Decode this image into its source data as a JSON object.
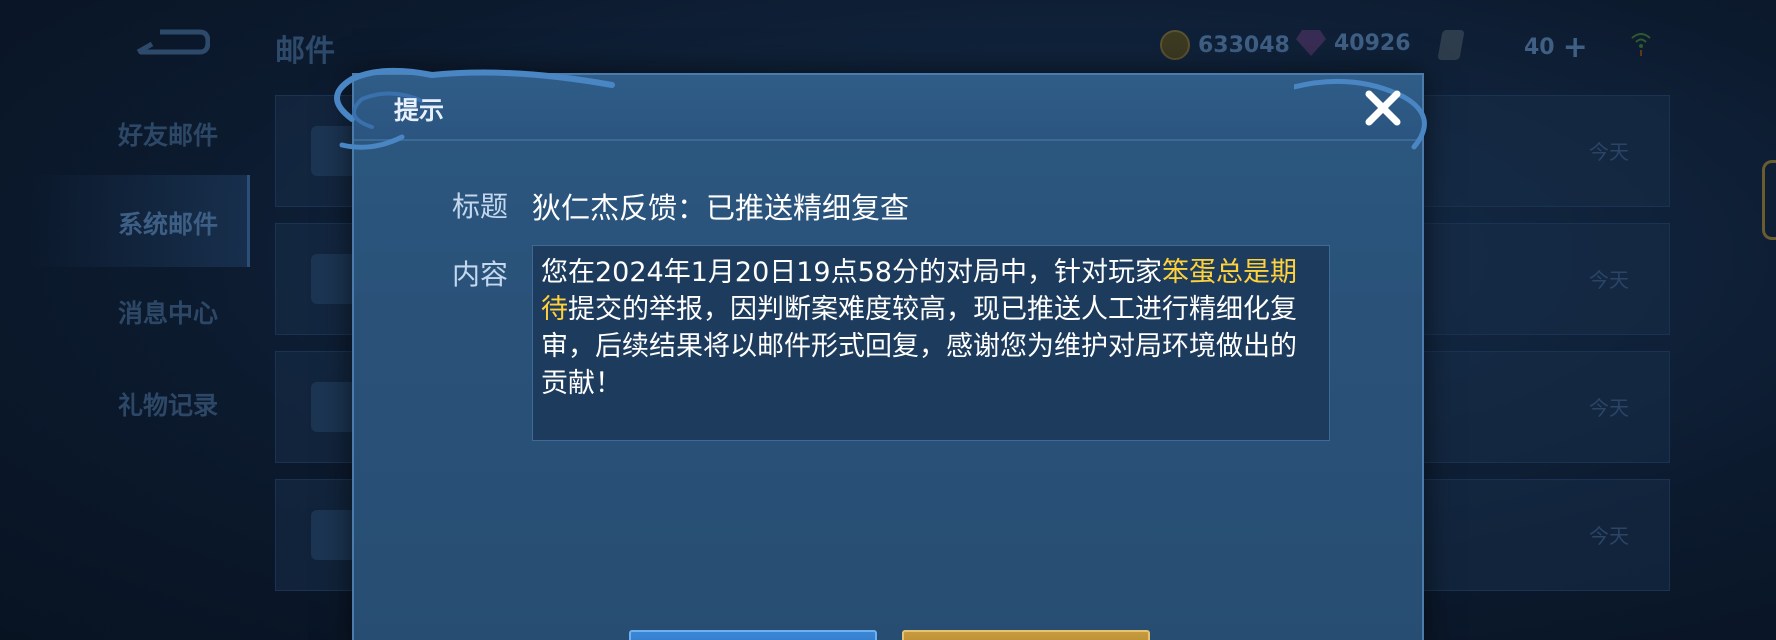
{
  "header": {
    "title": "邮件",
    "gold": "633048",
    "gems": "40926",
    "level": "40"
  },
  "sidebar": {
    "items": [
      {
        "label": "好友邮件"
      },
      {
        "label": "系统邮件"
      },
      {
        "label": "消息中心"
      },
      {
        "label": "礼物记录"
      }
    ]
  },
  "mail_list": {
    "dates": [
      "今天",
      "今天",
      "今天",
      "今天"
    ]
  },
  "dialog": {
    "title": "提示",
    "subject_label": "标题",
    "subject": "狄仁杰反馈：已推送精细复查",
    "content_label": "内容",
    "content_before": "您在2024年1月20日19点58分的对局中，针对玩家",
    "content_player": "笨蛋总是期待",
    "content_after": "提交的举报，因判断案难度较高，现已推送人工进行精细化复审，后续结果将以邮件形式回复，感谢您为维护对局环境做出的贡献！"
  },
  "colors": {
    "highlight": "#ffd23c",
    "dialog_bg": "#2a5279",
    "confirm_blue": "#2a6cb8",
    "gold_button": "#a57a25"
  }
}
